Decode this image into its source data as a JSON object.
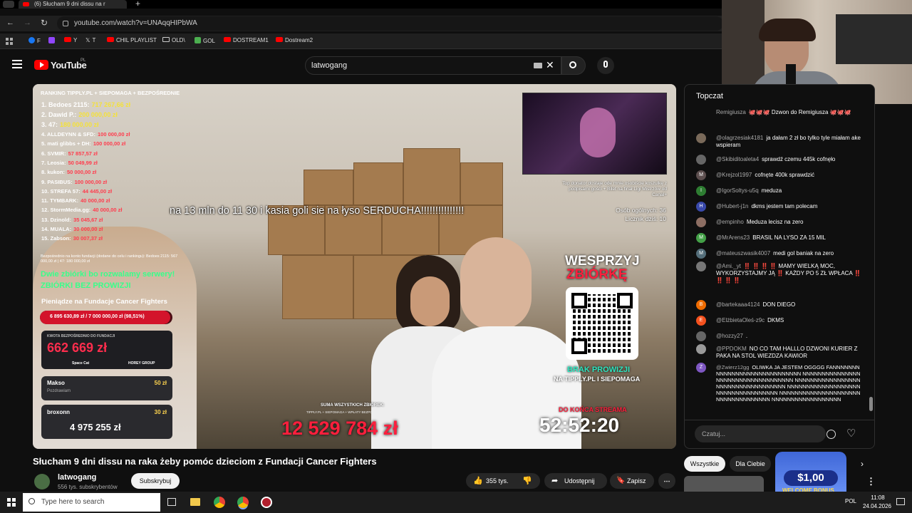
{
  "browser": {
    "tab_title": "(6) Słucham 9 dni dissu na r",
    "url": "youtube.com/watch?v=UNAqqHIPbWA",
    "bookmarks": [
      "F",
      "Y",
      "T",
      "CHIL PLAYLIST",
      "OLD\\",
      "GOL",
      "DOSTREAM1",
      "Dostream2"
    ]
  },
  "youtube": {
    "logo": "YouTube",
    "logo_region": "PL",
    "search_value": "latwogang"
  },
  "overlay": {
    "ranking_title": "RANKING TIPPLY.PL + SIEPOMAGA + BEZPOŚREDNIE",
    "ranking": [
      {
        "label": "1. Bedoes 2115:",
        "value": "717 267,66 zł"
      },
      {
        "label": "2. Dawid P.:",
        "value": "200 000,00 zł"
      },
      {
        "label": "3. 47:",
        "value": "180 000,00 zł"
      },
      {
        "label": "4. ALLDEYNN & SFD:",
        "value": "100 000,00 zł"
      },
      {
        "label": "5. mati glibbs + DH:",
        "value": "100 000,00 zł"
      },
      {
        "label": "6. SVMIR:",
        "value": "57 857,57 zł"
      },
      {
        "label": "7. Leosia:",
        "value": "50 049,99 zł"
      },
      {
        "label": "8. kukon:",
        "value": "50 000,00 zł"
      },
      {
        "label": "9. PASIBUS:",
        "value": "100 000,00 zł"
      },
      {
        "label": "10. STREFA 57:",
        "value": "44 445,00 zł"
      },
      {
        "label": "11. TYMBARK:",
        "value": "40 000,00 zł"
      },
      {
        "label": "12. StormMedia.gg:",
        "value": "40 000,00 zł"
      },
      {
        "label": "13. Dzinold:",
        "value": "35 045,67 zł"
      },
      {
        "label": "14. MUALA:",
        "value": "30 000,00 zł"
      },
      {
        "label": "15. Zabson:",
        "value": "30 007,37 zł"
      }
    ],
    "direct_note": "Bezpośrednio na konto fundacji (dodane do celu i rankingu): Bedoes 2115: 567 000,00 zł | 47: 180 000,00 zł",
    "servers_line1": "Dwie zbiórki bo rozwalamy serwery!",
    "servers_line2": "ZBIÓRKI BEZ PROWIZJI",
    "fund_title": "Pieniądze na Fundacje Cancer Fighters",
    "fund_progress_text": "6 895 630,89 zł / 7 000 000,00 zł (98,51%)",
    "fund_progress": 0.9851,
    "direct_box_label": "KWOTA BEZPOŚREDNIO DO FUNDACJI",
    "direct_amount": "662 669 zł",
    "sponsors": [
      "Space Cat",
      "HOREY GROUP"
    ],
    "donation1_name": "Makso",
    "donation1_amount": "50 zł",
    "donation1_msg": "Pozdrawiam",
    "donation2_name": "broxonn",
    "donation2_amount": "30 zł",
    "donation2_big": "4 975 255 zł",
    "center_text": "na 13 mln do 11 30 i kasia goli sie na łyso SERDUCHA!!!!!!!!!!!!!!!",
    "topdonor_text": "Top donator dostaje ode mnie osobiście koszulkę z podpisami gości + Bilet na finał Ligi Mistrzów od Canal+",
    "people_count": "Osób ogólnych: 36",
    "counter": "Licznik dziś: 10",
    "support_line1": "WESPRZYJ",
    "support_line2": "ZBIÓRKĘ",
    "no_fee_line1": "BRAK PROWIZJI",
    "no_fee_line2": "NA TIPPLY.PL I SIEPOMAGA",
    "sum_label": "SUMA WSZYSTKICH ZBIÓREK:",
    "sum_sub": "TIPPLY.PL + SIEPOMAGA + WPŁATY BEZPOŚREDNIE",
    "sum_value": "12 529 784 zł",
    "end_label": "DO KOŃCA STREAMA",
    "timer": "52:52:20"
  },
  "chat": {
    "header": "Topczat",
    "placeholder": "Czatuj...",
    "messages": [
      {
        "avatar": "",
        "author": "Remigiusza",
        "text": "🐙🐙🐙 Dzwon do Remigiusza 🐙🐙🐙",
        "color": "#555"
      },
      {
        "avatar": "",
        "author": "@olagrzesiak4181",
        "text": "ja dałam 2 zł bo tylko tyle miałam ake wspieram",
        "color": "#7a6a5a"
      },
      {
        "avatar": "",
        "author": "@Skibiditoaleta4",
        "text": "sprawdź czemu 445k cofnęło",
        "color": "#666"
      },
      {
        "avatar": "M",
        "author": "@Krejzol1997",
        "text": "cofnęte 400k sprawdzić",
        "color": "#5c4e4e"
      },
      {
        "avatar": "I",
        "author": "@IgorSoltys-u5q",
        "text": "meduza",
        "color": "#2e7d32"
      },
      {
        "avatar": "H",
        "author": "@Hubert-j1n",
        "text": "dkms jestem tam polecam",
        "color": "#3949ab"
      },
      {
        "avatar": "",
        "author": "@empinho",
        "text": "Meduza lecisz na zero",
        "color": "#8d6e63"
      },
      {
        "avatar": "M",
        "author": "@MrArens23",
        "text": "BRASIL NA LYSO ZA 15 MIL",
        "color": "#43a047"
      },
      {
        "avatar": "M",
        "author": "@mateuszwasik4007",
        "text": "medi gol baniak na zero",
        "color": "#546e7a"
      },
      {
        "avatar": "",
        "author": "@Ami._yt",
        "text": "‼️ ‼️ ‼️ ‼️ MAMY WIELKĄ MOC, WYKORZYSTAJMY JĄ ‼️ KAŻDY PO 5 ZŁ WPŁACA ‼️ ‼️ ‼️ ‼️",
        "color": "#777"
      },
      {
        "avatar": "B",
        "author": "@bartekaaa4124",
        "text": "DON DIEGO",
        "color": "#ef6c00"
      },
      {
        "avatar": "E",
        "author": "@ElżbietaOleś-z9c",
        "text": "DKMS",
        "color": "#f4511e"
      },
      {
        "avatar": "",
        "author": "@hozzy27",
        "text": ".",
        "color": "#666"
      },
      {
        "avatar": "",
        "author": "@PPDOKM",
        "text": "NO CO TAM HALLLO DZWONI KURIER Z PAKA NA STOL WIEZDZA KAWIOR",
        "color": "#999"
      },
      {
        "avatar": "Z",
        "author": "@Zwierz12gg",
        "text": "OLIWKA JA JESTEM OGGGG FANNNNNNNNNNNNNNNNNNNNNNNNNNNNN NNNNNNNNNNNNNNNNNNNNNNNNNNNNNNNNNNN NNNNNNNNNNNNNNNNNNNNNNNNNNNNNNNNNNN NNNNNNNNNNNNNNNNNNNNNNNNNNNNNNNNNNN NNNNNNNNNNNNNNNNNNNNNNNNNNNNNNNNNNN NNNNNNNNNNNNNNNNNN",
        "color": "#7e57c2"
      }
    ]
  },
  "video": {
    "title": "Słucham 9 dni dissu na raka żeby pomóc dzieciom z Fundacji Cancer Fighters",
    "channel": "latwogang",
    "subs": "556 tys. subskrybentów",
    "subscribe_label": "Subskrybuj",
    "likes": "355 tys.",
    "share_label": "Udostępnij",
    "save_label": "Zapisz"
  },
  "filters": [
    "Wszystkie",
    "Dla Ciebie"
  ],
  "ad": {
    "amount": "$1,00",
    "text": "WELCOME BONUS"
  },
  "taskbar": {
    "search_placeholder": "Type here to search",
    "time": "11:08",
    "date": "24.04.2026",
    "lang": "POL"
  }
}
